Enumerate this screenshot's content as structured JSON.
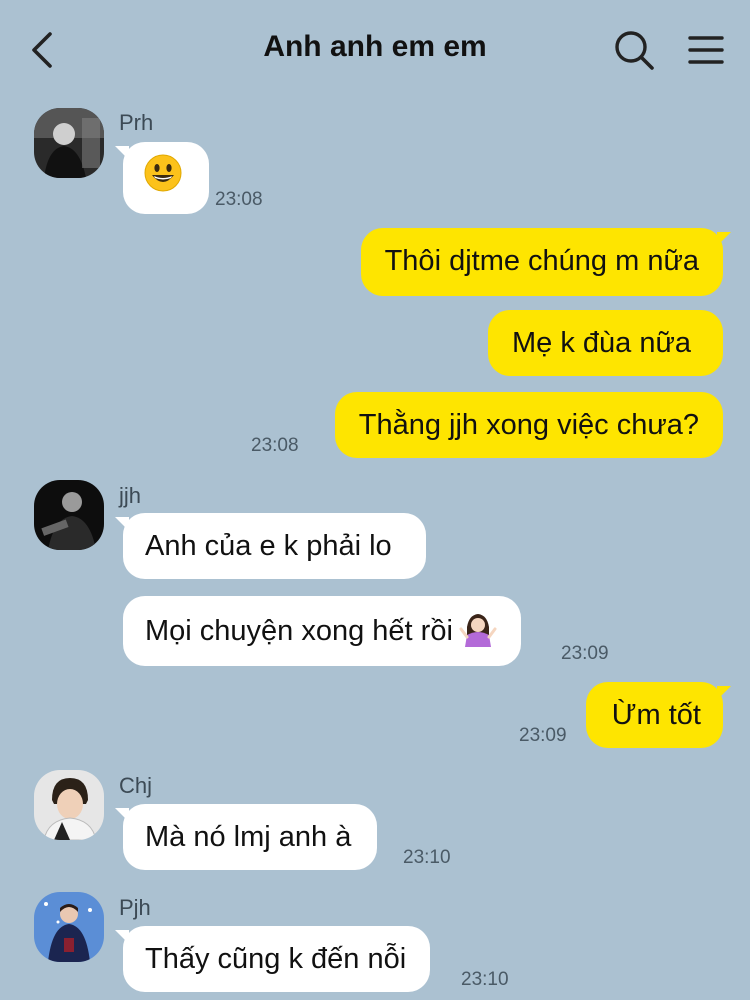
{
  "header": {
    "title": "Anh anh em em",
    "back_icon": "chevron-left-icon",
    "search_icon": "search-icon",
    "menu_icon": "hamburger-menu-icon"
  },
  "colors": {
    "background": "#abc1d1",
    "outgoing_bubble": "#fee500",
    "incoming_bubble": "#ffffff"
  },
  "messages": [
    {
      "sender": "Prh",
      "direction": "in",
      "emoji": "grinning-face",
      "time": "23:08"
    },
    {
      "direction": "out",
      "text": "Thôi djtme chúng m nữa"
    },
    {
      "direction": "out",
      "text": "Mẹ k đùa nữa"
    },
    {
      "direction": "out",
      "text": "Thằng jjh xong việc chưa?",
      "time": "23:08"
    },
    {
      "sender": "jjh",
      "direction": "in",
      "text": "Anh của e k phải lo"
    },
    {
      "direction": "in",
      "text": "Mọi chuyện xong hết rồi",
      "emoji": "person-shrugging",
      "time": "23:09"
    },
    {
      "direction": "out",
      "text": "Ừm tốt",
      "time": "23:09"
    },
    {
      "sender": "Chj",
      "direction": "in",
      "text": "Mà nó lmj anh à",
      "time": "23:10"
    },
    {
      "sender": "Pjh",
      "direction": "in",
      "text": "Thấy cũng k đến nỗi",
      "time": "23:10"
    }
  ]
}
